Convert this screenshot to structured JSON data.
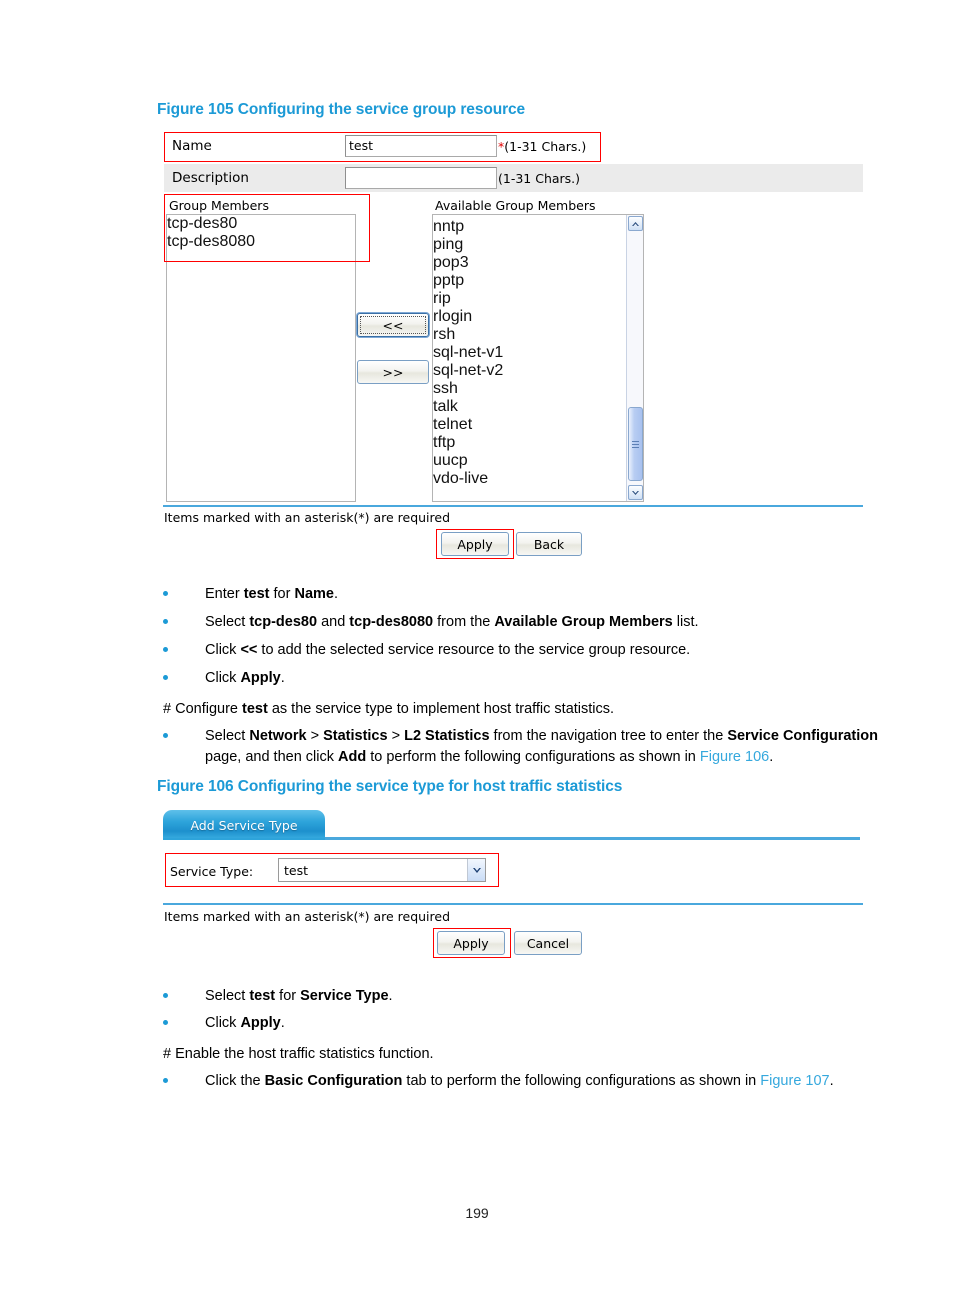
{
  "page": {
    "number": "199"
  },
  "figure105": {
    "caption": "Figure 105 Configuring the service group resource",
    "name_label": "Name",
    "name_value": "test",
    "name_hint_star": "*",
    "name_hint": "(1-31 Chars.)",
    "description_label": "Description",
    "description_value": "",
    "description_hint": "(1-31 Chars.)",
    "group_members_label": "Group Members",
    "group_members": [
      "tcp-des80",
      "tcp-des8080"
    ],
    "available_label": "Available Group Members",
    "available_members": [
      "nntp",
      "ping",
      "pop3",
      "pptp",
      "rip",
      "rlogin",
      "rsh",
      "sql-net-v1",
      "sql-net-v2",
      "ssh",
      "talk",
      "telnet",
      "tftp",
      "uucp",
      "vdo-live"
    ],
    "move_left_label": "<<",
    "move_right_label": ">>",
    "required_note": "Items marked with an asterisk(*) are required",
    "apply_label": "Apply",
    "back_label": "Back",
    "scroll_up_glyph": "▲",
    "scroll_down_glyph": "▼"
  },
  "steps1": [
    {
      "html": "Enter <b>test</b> for <b>Name</b>."
    },
    {
      "html": "Select <b>tcp-des80</b> and <b>tcp-des8080</b> from the <b>Available Group Members</b> list."
    },
    {
      "html": "Click <b>&lt;&lt;</b> to add the selected service resource to the service group resource."
    },
    {
      "html": "Click <b>Apply</b>."
    }
  ],
  "note1": {
    "html": "# Configure <b>test</b> as the service type to implement host traffic statistics."
  },
  "steps2": [
    {
      "html": "Select <b>Network</b> &gt; <b>Statistics</b> &gt; <b>L2 Statistics</b> from the navigation tree to enter the <b>Service Configuration</b><br>page, and then click <b>Add</b> to perform the following configurations as shown in <span class=\"xref\">Figure 106</span>."
    }
  ],
  "figure106": {
    "caption": "Figure 106 Configuring the service type for host traffic statistics",
    "tab_label": "Add Service Type",
    "service_type_label": "Service Type:",
    "service_type_value": "test",
    "dropdown_glyph": "▼",
    "required_note": "Items marked with an asterisk(*) are required",
    "apply_label": "Apply",
    "cancel_label": "Cancel"
  },
  "steps3": [
    {
      "html": "Select <b>test</b> for <b>Service Type</b>."
    },
    {
      "html": "Click <b>Apply</b>."
    }
  ],
  "note2": {
    "html": "# Enable the host traffic statistics function."
  },
  "steps4": [
    {
      "html": "Click the <b>Basic Configuration</b> tab to perform the following configurations as shown in <span class=\"xref\">Figure 107</span>."
    }
  ]
}
